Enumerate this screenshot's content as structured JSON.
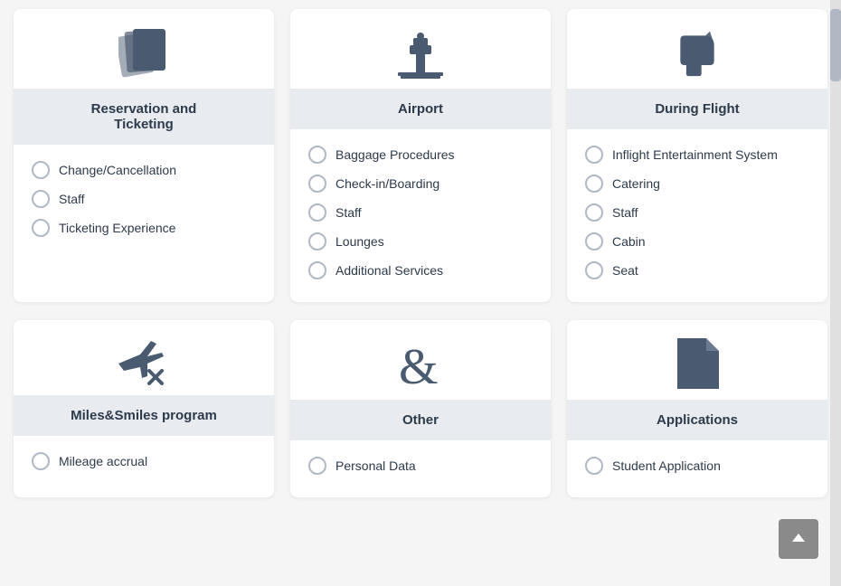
{
  "rows": [
    {
      "cards": [
        {
          "id": "reservation-ticketing",
          "icon": "cards",
          "header": "Reservation and\nTicketing",
          "items": [
            "Change/Cancellation",
            "Staff",
            "Ticketing Experience"
          ]
        },
        {
          "id": "airport",
          "icon": "tower",
          "header": "Airport",
          "items": [
            "Baggage Procedures",
            "Check-in/Boarding",
            "Staff",
            "Lounges",
            "Additional Services"
          ]
        },
        {
          "id": "during-flight",
          "icon": "seat-star",
          "header": "During Flight",
          "items": [
            "Inflight Entertainment System",
            "Catering",
            "Staff",
            "Cabin",
            "Seat"
          ]
        }
      ]
    },
    {
      "cards": [
        {
          "id": "miles-smiles",
          "icon": "plane-cancel",
          "header": "Miles&Smiles program",
          "items": [
            "Mileage accrual"
          ]
        },
        {
          "id": "other",
          "icon": "ampersand",
          "header": "Other",
          "items": [
            "Personal Data"
          ]
        },
        {
          "id": "applications",
          "icon": "document",
          "header": "Applications",
          "items": [
            "Student Application"
          ]
        }
      ]
    }
  ],
  "back_to_top_label": "↑"
}
